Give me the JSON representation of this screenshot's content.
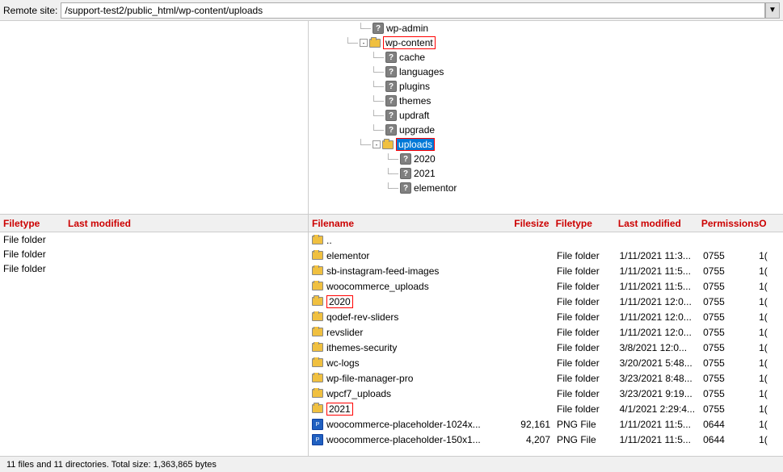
{
  "header": {
    "remote_label": "Remote site:",
    "remote_path": "/support-test2/public_html/wp-content/uploads",
    "dropdown_char": "▼"
  },
  "left_panel": {
    "col_headers": {
      "filetype": "Filetype",
      "last_modified": "Last modified"
    },
    "rows": [
      {
        "filetype": "File folder",
        "modified": ""
      },
      {
        "filetype": "File folder",
        "modified": ""
      },
      {
        "filetype": "File folder",
        "modified": ""
      }
    ]
  },
  "tree": {
    "items": [
      {
        "id": "wp-admin",
        "label": "wp-admin",
        "indent": 3,
        "type": "question",
        "expand": null
      },
      {
        "id": "wp-content",
        "label": "wp-content",
        "indent": 2,
        "type": "folder-open",
        "expand": "-",
        "boxed": true
      },
      {
        "id": "cache",
        "label": "cache",
        "indent": 4,
        "type": "question",
        "expand": null
      },
      {
        "id": "languages",
        "label": "languages",
        "indent": 4,
        "type": "question",
        "expand": null
      },
      {
        "id": "plugins",
        "label": "plugins",
        "indent": 4,
        "type": "question",
        "expand": null
      },
      {
        "id": "themes",
        "label": "themes",
        "indent": 4,
        "type": "question",
        "expand": null
      },
      {
        "id": "updraft",
        "label": "updraft",
        "indent": 4,
        "type": "question",
        "expand": null
      },
      {
        "id": "upgrade",
        "label": "upgrade",
        "indent": 4,
        "type": "question",
        "expand": null
      },
      {
        "id": "uploads",
        "label": "uploads",
        "indent": 3,
        "type": "folder-open",
        "expand": "-",
        "highlighted": true,
        "boxed": true
      },
      {
        "id": "2020",
        "label": "2020",
        "indent": 5,
        "type": "question",
        "expand": null
      },
      {
        "id": "2021",
        "label": "2021",
        "indent": 5,
        "type": "question",
        "expand": null
      },
      {
        "id": "elementor",
        "label": "elementor",
        "indent": 5,
        "type": "question",
        "expand": null
      }
    ]
  },
  "file_headers": {
    "filename": "Filename",
    "filesize": "Filesize",
    "filetype": "Filetype",
    "last_modified": "Last modified",
    "permissions": "Permissions",
    "o": "O"
  },
  "files": [
    {
      "name": "..",
      "size": "",
      "type": "",
      "modified": "",
      "perms": "",
      "o": "",
      "icon": "folder"
    },
    {
      "name": "elementor",
      "size": "",
      "type": "File folder",
      "modified": "1/11/2021 11:3...",
      "perms": "0755",
      "o": "1(",
      "icon": "folder"
    },
    {
      "name": "sb-instagram-feed-images",
      "size": "",
      "type": "File folder",
      "modified": "1/11/2021 11:5...",
      "perms": "0755",
      "o": "1(",
      "icon": "folder"
    },
    {
      "name": "woocommerce_uploads",
      "size": "",
      "type": "File folder",
      "modified": "1/11/2021 11:5...",
      "perms": "0755",
      "o": "1(",
      "icon": "folder"
    },
    {
      "name": "2020",
      "size": "",
      "type": "File folder",
      "modified": "1/11/2021 12:0...",
      "perms": "0755",
      "o": "1(",
      "icon": "folder",
      "boxed": true
    },
    {
      "name": "qodef-rev-sliders",
      "size": "",
      "type": "File folder",
      "modified": "1/11/2021 12:0...",
      "perms": "0755",
      "o": "1(",
      "icon": "folder"
    },
    {
      "name": "revslider",
      "size": "",
      "type": "File folder",
      "modified": "1/11/2021 12:0...",
      "perms": "0755",
      "o": "1(",
      "icon": "folder"
    },
    {
      "name": "ithemes-security",
      "size": "",
      "type": "File folder",
      "modified": "3/8/2021 12:0...",
      "perms": "0755",
      "o": "1(",
      "icon": "folder"
    },
    {
      "name": "wc-logs",
      "size": "",
      "type": "File folder",
      "modified": "3/20/2021 5:48...",
      "perms": "0755",
      "o": "1(",
      "icon": "folder"
    },
    {
      "name": "wp-file-manager-pro",
      "size": "",
      "type": "File folder",
      "modified": "3/23/2021 8:48...",
      "perms": "0755",
      "o": "1(",
      "icon": "folder"
    },
    {
      "name": "wpcf7_uploads",
      "size": "",
      "type": "File folder",
      "modified": "3/23/2021 9:19...",
      "perms": "0755",
      "o": "1(",
      "icon": "folder"
    },
    {
      "name": "2021",
      "size": "",
      "type": "File folder",
      "modified": "4/1/2021 2:29:4...",
      "perms": "0755",
      "o": "1(",
      "icon": "folder",
      "boxed": true
    },
    {
      "name": "woocommerce-placeholder-1024x...",
      "size": "92,161",
      "type": "PNG File",
      "modified": "1/11/2021 11:5...",
      "perms": "0644",
      "o": "1(",
      "icon": "png"
    },
    {
      "name": "woocommerce-placeholder-150x1...",
      "size": "4,207",
      "type": "PNG File",
      "modified": "1/11/2021 11:5...",
      "perms": "0644",
      "o": "1(",
      "icon": "png"
    }
  ],
  "status": {
    "text": "11 files and 11 directories. Total size: 1,363,865 bytes"
  }
}
